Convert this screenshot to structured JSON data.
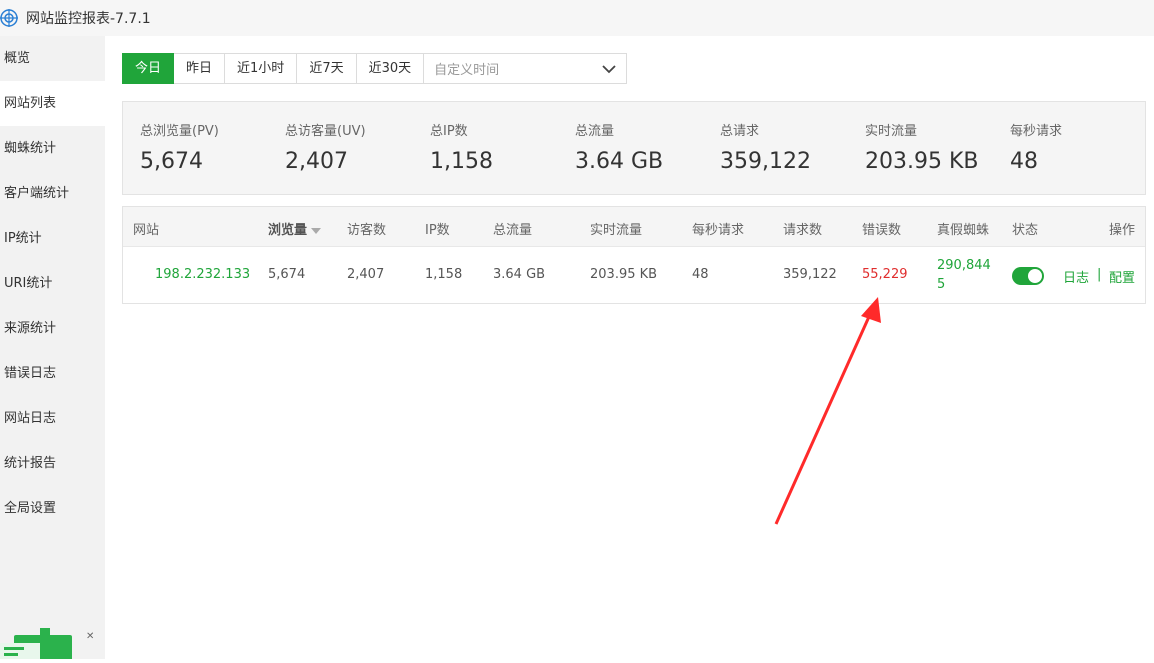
{
  "window": {
    "title": "网站监控报表-7.7.1"
  },
  "sidebar": {
    "items": [
      {
        "label": "概览"
      },
      {
        "label": "网站列表"
      },
      {
        "label": "蜘蛛统计"
      },
      {
        "label": "客户端统计"
      },
      {
        "label": "IP统计"
      },
      {
        "label": "URI统计"
      },
      {
        "label": "来源统计"
      },
      {
        "label": "错误日志"
      },
      {
        "label": "网站日志"
      },
      {
        "label": "统计报告"
      },
      {
        "label": "全局设置"
      }
    ],
    "active_index": 1
  },
  "toolbar": {
    "ranges": [
      {
        "label": "今日"
      },
      {
        "label": "昨日"
      },
      {
        "label": "近1小时"
      },
      {
        "label": "近7天"
      },
      {
        "label": "近30天"
      }
    ],
    "active_index": 0,
    "custom_placeholder": "自定义时间"
  },
  "summary": {
    "stats": [
      {
        "label": "总浏览量(PV)",
        "value": "5,674"
      },
      {
        "label": "总访客量(UV)",
        "value": "2,407"
      },
      {
        "label": "总IP数",
        "value": "1,158"
      },
      {
        "label": "总流量",
        "value": "3.64 GB"
      },
      {
        "label": "总请求",
        "value": "359,122"
      },
      {
        "label": "实时流量",
        "value": "203.95 KB"
      },
      {
        "label": "每秒请求",
        "value": "48"
      }
    ]
  },
  "table": {
    "headers": {
      "site": "网站",
      "pv": "浏览量",
      "uv": "访客数",
      "ip": "IP数",
      "traffic": "总流量",
      "realtime": "实时流量",
      "qps": "每秒请求",
      "requests": "请求数",
      "errors": "错误数",
      "spider": "真假蜘蛛",
      "status": "状态",
      "actions": "操作"
    },
    "rows": [
      {
        "site": "198.2.232.133",
        "pv": "5,674",
        "uv": "2,407",
        "ip": "1,158",
        "traffic": "3.64 GB",
        "realtime": "203.95 KB",
        "qps": "48",
        "requests": "359,122",
        "errors": "55,229",
        "spider_line1": "290,844",
        "spider_line2": "5",
        "status_on": true,
        "action_log": "日志",
        "action_sep": "|",
        "action_config": "配置"
      }
    ]
  },
  "colors": {
    "accent": "#20a53a",
    "error": "#e02d2d",
    "annotation_arrow": "#ff2a2a"
  }
}
